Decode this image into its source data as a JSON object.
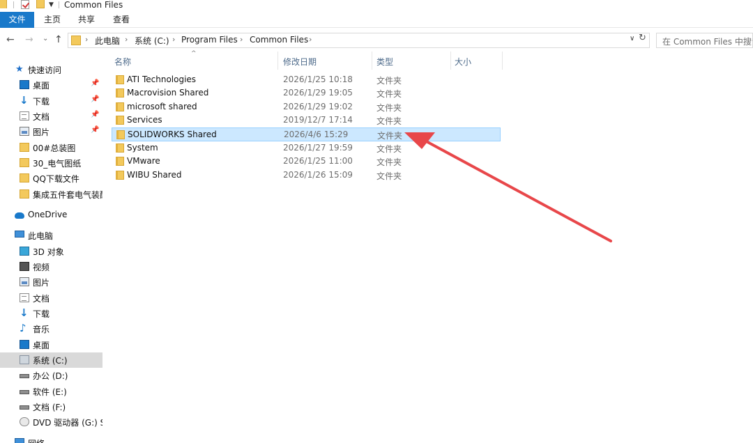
{
  "window": {
    "title": "Common Files"
  },
  "ribbon": {
    "tabs": [
      "文件",
      "主页",
      "共享",
      "查看"
    ]
  },
  "address": {
    "crumbs": [
      "此电脑",
      "系统 (C:)",
      "Program Files",
      "Common Files"
    ],
    "search_placeholder": "在 Common Files 中搜索"
  },
  "sidebar": {
    "quick_access": "快速访问",
    "quick_items": [
      "桌面",
      "下载",
      "文档",
      "图片",
      "00#总装图",
      "30_电气图纸",
      "QQ下载文件",
      "集成五件套电气装配"
    ],
    "onedrive": "OneDrive",
    "this_pc": "此电脑",
    "pc_items": [
      "3D 对象",
      "视频",
      "图片",
      "文档",
      "下载",
      "音乐",
      "桌面",
      "系统 (C:)",
      "办公 (D:)",
      "软件 (E:)",
      "文档 (F:)",
      "DVD 驱动器 (G:) SolidWorks"
    ],
    "network": "网络"
  },
  "columns": {
    "name": "名称",
    "modified": "修改日期",
    "type": "类型",
    "size": "大小"
  },
  "files": [
    {
      "name": "ATI Technologies",
      "date": "2026/1/25 10:18",
      "type": "文件夹"
    },
    {
      "name": "Macrovision Shared",
      "date": "2026/1/29 19:05",
      "type": "文件夹"
    },
    {
      "name": "microsoft shared",
      "date": "2026/1/29 19:02",
      "type": "文件夹"
    },
    {
      "name": "Services",
      "date": "2019/12/7 17:14",
      "type": "文件夹"
    },
    {
      "name": "SOLIDWORKS Shared",
      "date": "2026/4/6 15:29",
      "type": "文件夹"
    },
    {
      "name": "System",
      "date": "2026/1/27 19:59",
      "type": "文件夹"
    },
    {
      "name": "VMware",
      "date": "2026/1/25 11:00",
      "type": "文件夹"
    },
    {
      "name": "WIBU Shared",
      "date": "2026/1/26 15:09",
      "type": "文件夹"
    }
  ],
  "selected_file": "SOLIDWORKS Shared",
  "colors": {
    "accent": "#1979ca",
    "selection": "#cce8ff",
    "annotation_arrow": "#e8474a"
  }
}
